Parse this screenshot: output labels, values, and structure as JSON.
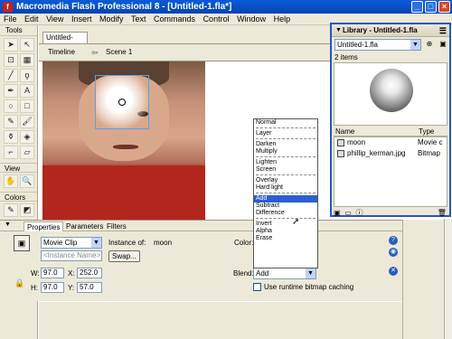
{
  "window": {
    "title": "Macromedia Flash Professional 8 - [Untitled-1.fla*]",
    "app_icon": "f"
  },
  "menus": [
    "File",
    "Edit",
    "View",
    "Insert",
    "Modify",
    "Text",
    "Commands",
    "Control",
    "Window",
    "Help"
  ],
  "tools": {
    "header": "Tools",
    "buttons": [
      {
        "icon": "arrow-icon",
        "glyph": "➤"
      },
      {
        "icon": "subselect-icon",
        "glyph": "↖"
      },
      {
        "icon": "free-transform-icon",
        "glyph": "⊡"
      },
      {
        "icon": "fill-transform-icon",
        "glyph": "▦"
      },
      {
        "icon": "line-icon",
        "glyph": "╱"
      },
      {
        "icon": "lasso-icon",
        "glyph": "ϙ"
      },
      {
        "icon": "pen-icon",
        "glyph": "✒"
      },
      {
        "icon": "text-icon",
        "glyph": "A"
      },
      {
        "icon": "oval-icon",
        "glyph": "○"
      },
      {
        "icon": "rectangle-icon",
        "glyph": "□"
      },
      {
        "icon": "pencil-icon",
        "glyph": "✎"
      },
      {
        "icon": "brush-icon",
        "glyph": "🖌"
      },
      {
        "icon": "ink-bottle-icon",
        "glyph": "⚱"
      },
      {
        "icon": "paint-bucket-icon",
        "glyph": "◈"
      },
      {
        "icon": "eyedropper-icon",
        "glyph": "⌐"
      },
      {
        "icon": "eraser-icon",
        "glyph": "▱"
      }
    ],
    "view_label": "View",
    "view_buttons": [
      {
        "icon": "hand-icon",
        "glyph": "✋"
      },
      {
        "icon": "zoom-icon",
        "glyph": "🔍"
      }
    ],
    "colors_label": "Colors",
    "color_buttons": [
      {
        "icon": "stroke-color-icon",
        "glyph": "✎"
      },
      {
        "icon": "fill-color-icon",
        "glyph": "◩"
      }
    ]
  },
  "document": {
    "tab": "Untitled-1.fla*",
    "timeline_label": "Timeline",
    "scene_label": "Scene 1",
    "back_glyph": "⇦"
  },
  "blend_menu": {
    "groups": [
      [
        "Normal"
      ],
      [
        "Layer"
      ],
      [
        "Darken",
        "Multiply"
      ],
      [
        "Lighten",
        "Screen"
      ],
      [
        "Overlay",
        "Hard light"
      ],
      [
        "Add",
        "Subtract",
        "Difference"
      ],
      [
        "Invert",
        "Alpha",
        "Erase"
      ]
    ],
    "selected": "Add"
  },
  "library": {
    "title": "Library - Untitled-1.fla",
    "file_select": "Untitled-1.fla",
    "count": "2 items",
    "col_name": "Name",
    "col_type": "Type",
    "items": [
      {
        "name": "moon",
        "type": "Movie c"
      },
      {
        "name": "phillip_kerman.jpg",
        "type": "Bitmap"
      }
    ],
    "preview_symbol": "moon"
  },
  "properties": {
    "tabs": [
      "Properties",
      "Parameters",
      "Filters"
    ],
    "active_tab": "Properties",
    "symbol_type": "Movie Clip",
    "instance_of_label": "Instance of:",
    "instance_of_value": "moon",
    "instance_name_placeholder": "<Instance Name>",
    "swap_label": "Swap...",
    "color_label": "Color:",
    "blend_label": "Blend:",
    "blend_value": "Add",
    "cache_label": "Use runtime bitmap caching",
    "w_label": "W:",
    "w_value": "97.0",
    "h_label": "H:",
    "h_value": "97.0",
    "x_label": "X:",
    "x_value": "252.0",
    "y_label": "Y:",
    "y_value": "57.0"
  }
}
